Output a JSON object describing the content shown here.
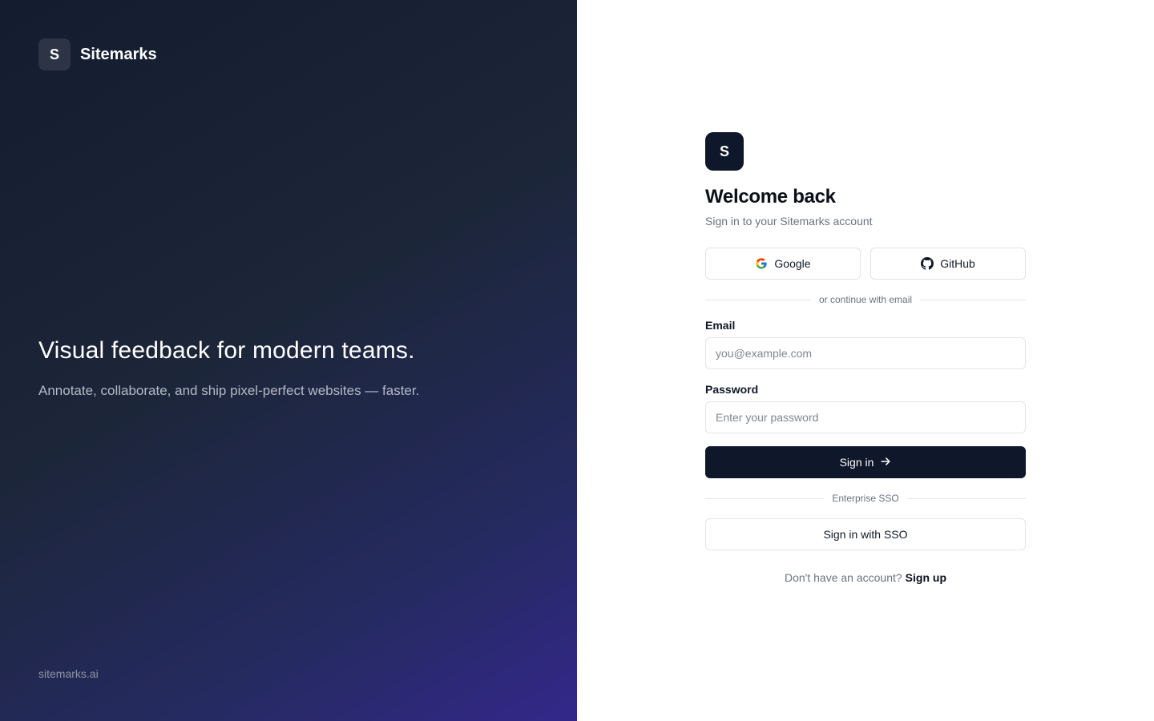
{
  "brand": {
    "logo_letter": "S",
    "name": "Sitemarks"
  },
  "hero": {
    "title": "Visual feedback for modern teams.",
    "subtitle": "Annotate, collaborate, and ship pixel-perfect websites — faster."
  },
  "footer": {
    "link": "sitemarks.ai"
  },
  "form": {
    "logo_letter": "S",
    "title": "Welcome back",
    "subtitle": "Sign in to your Sitemarks account",
    "oauth": {
      "google_label": "Google",
      "github_label": "GitHub"
    },
    "divider_email": "or continue with email",
    "email": {
      "label": "Email",
      "placeholder": "you@example.com",
      "value": ""
    },
    "password": {
      "label": "Password",
      "placeholder": "Enter your password",
      "value": ""
    },
    "submit_label": "Sign in",
    "divider_sso": "Enterprise SSO",
    "sso_label": "Sign in with SSO",
    "signup_prompt": "Don't have an account?",
    "signup_link": "Sign up"
  },
  "icons": {
    "google": "google-icon",
    "github": "github-icon",
    "submit": "arrow-right-icon"
  },
  "colors": {
    "primary": "#0f172a",
    "left_gradient_start": "#141c30",
    "left_gradient_end": "#33288a",
    "muted_text": "#6b7280",
    "border": "#e2e4e9"
  }
}
